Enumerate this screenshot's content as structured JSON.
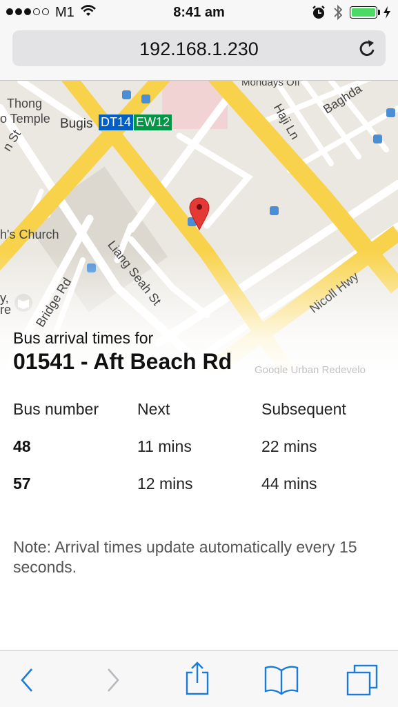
{
  "status_bar": {
    "carrier": "M1",
    "time": "8:41 am",
    "signal_bars_filled": 3,
    "signal_bars_total": 5,
    "battery_color": "#4cd964"
  },
  "browser": {
    "url": "192.168.1.230",
    "reload_icon": "reload-icon"
  },
  "map": {
    "labels": {
      "thong": "Thong",
      "temple": "o Temple",
      "bugis": "Bugis",
      "mondays": "Mondays Off",
      "haji": "Haji Ln",
      "baghdad": "Baghda",
      "church": "h's Church",
      "liang": "Liang Seah St",
      "bridge": "Bridge Rd",
      "nicoll": "Nicoll Hwy",
      "st": "n St",
      "y": "y,",
      "re": "re"
    },
    "mrt_codes": [
      "DT14",
      "EW12"
    ],
    "mrt_colors": [
      "#005ec4",
      "#009645"
    ],
    "attribution": "Google  Urban Redevelo"
  },
  "page": {
    "title_prefix": "Bus arrival times for",
    "stop_title": "01541 - Aft Beach Rd",
    "table": {
      "headers": [
        "Bus number",
        "Next",
        "Subsequent"
      ],
      "rows": [
        [
          "48",
          "11 mins",
          "22 mins"
        ],
        [
          "57",
          "12 mins",
          "44 mins"
        ]
      ]
    },
    "note": "Note: Arrival times update automatically every 15 seconds."
  },
  "toolbar": {
    "icons": [
      "back-icon",
      "forward-icon",
      "share-icon",
      "bookmarks-icon",
      "tabs-icon"
    ],
    "accent": "#1a7bd9"
  }
}
